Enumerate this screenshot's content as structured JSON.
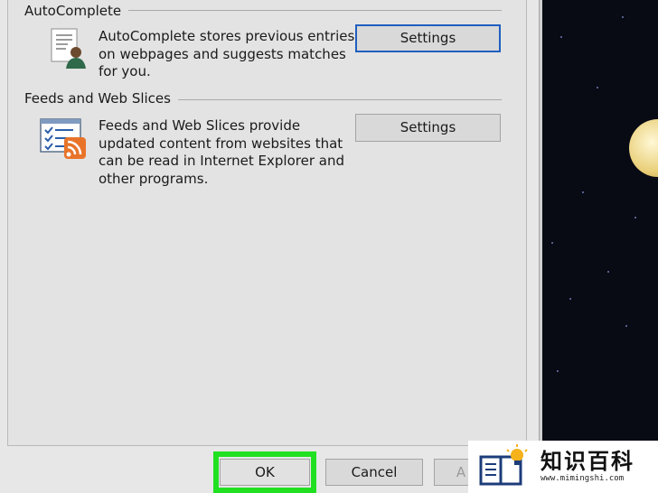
{
  "autocomplete": {
    "title": "AutoComplete",
    "description_lines": [
      "AutoComplete stores previous entries",
      "on webpages and suggests matches",
      "for you."
    ],
    "settings_label": "Settings"
  },
  "feeds": {
    "title": "Feeds and Web Slices",
    "description_lines": [
      "Feeds and Web Slices provide",
      "updated content from websites that",
      "can be read in Internet Explorer and",
      "other programs."
    ],
    "settings_label": "Settings"
  },
  "buttons": {
    "ok_label": "OK",
    "cancel_label": "Cancel",
    "apply_label": "A"
  },
  "watermark": {
    "text": "知识百科",
    "url": "www.mimingshi.com"
  },
  "colors": {
    "highlight": "#21e021",
    "focus_border": "#1f5fbf",
    "dialog_bg": "#e3e3e3",
    "rss_orange": "#e8742a"
  },
  "icons": {
    "autocomplete": "user-document-icon",
    "feeds": "feed-list-rss-icon",
    "watermark": "book-lightbulb-icon"
  }
}
